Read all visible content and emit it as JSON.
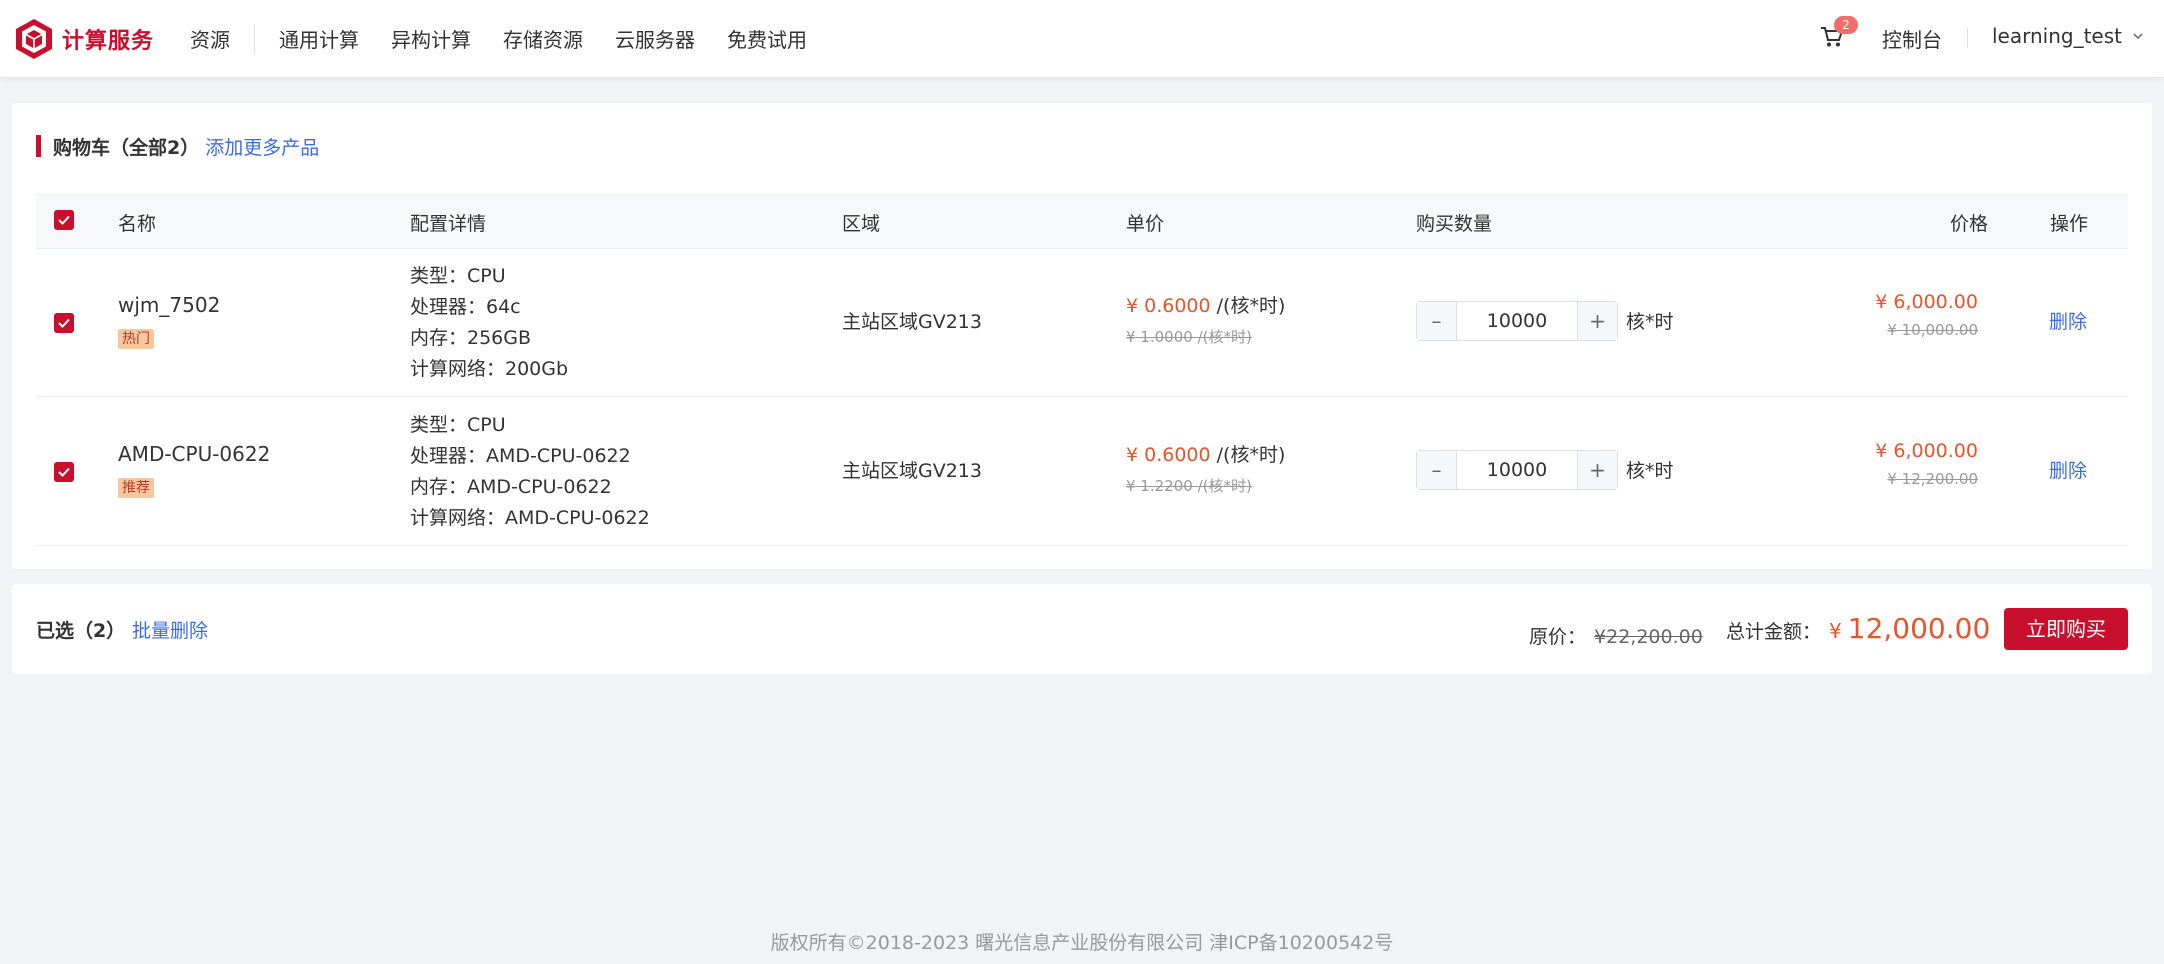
{
  "header": {
    "logo_text": "计算服务",
    "nav": [
      "资源",
      "通用计算",
      "异构计算",
      "存储资源",
      "云服务器",
      "免费试用"
    ],
    "cart_count": "2",
    "console_label": "控制台",
    "username": "learning_test",
    "brand_color": "#c8102e"
  },
  "cart": {
    "title": "购物车（全部2）",
    "add_more": "添加更多产品",
    "columns": {
      "name": "名称",
      "config": "配置详情",
      "region": "区域",
      "unit_price": "单价",
      "quantity": "购买数量",
      "price": "价格",
      "action": "操作"
    },
    "items": [
      {
        "name": "wjm_7502",
        "tag": "热门",
        "config": [
          "类型：CPU",
          "处理器：64c",
          "内存：256GB",
          "计算网络：200Gb"
        ],
        "region": "主站区域GV213",
        "unit_price": "¥ 0.6000",
        "unit_suffix": "/(核*时)",
        "unit_orig": "¥ 1.0000 /(核*时)",
        "quantity": "10000",
        "qty_unit": "核*时",
        "price": "¥ 6,000.00",
        "price_orig": "¥ 10,000.00",
        "delete": "删除",
        "checked": true
      },
      {
        "name": "AMD-CPU-0622",
        "tag": "推荐",
        "config": [
          "类型：CPU",
          "处理器：AMD-CPU-0622",
          "内存：AMD-CPU-0622",
          "计算网络：AMD-CPU-0622"
        ],
        "region": "主站区域GV213",
        "unit_price": "¥ 0.6000",
        "unit_suffix": "/(核*时)",
        "unit_orig": "¥ 1.2200 /(核*时)",
        "quantity": "10000",
        "qty_unit": "核*时",
        "price": "¥ 6,000.00",
        "price_orig": "¥ 12,200.00",
        "delete": "删除",
        "checked": true
      }
    ]
  },
  "summary": {
    "selected": "已选（2）",
    "batch_delete": "批量删除",
    "orig_label": "原价：",
    "orig_value": "¥22,200.00",
    "total_label": "总计金额：",
    "total_currency": "¥",
    "total_value": "12,000.00",
    "buy_label": "立即购买"
  },
  "footer": {
    "copyright": "版权所有©2018-2023    曙光信息产业股份有限公司    津ICP备10200542号"
  }
}
